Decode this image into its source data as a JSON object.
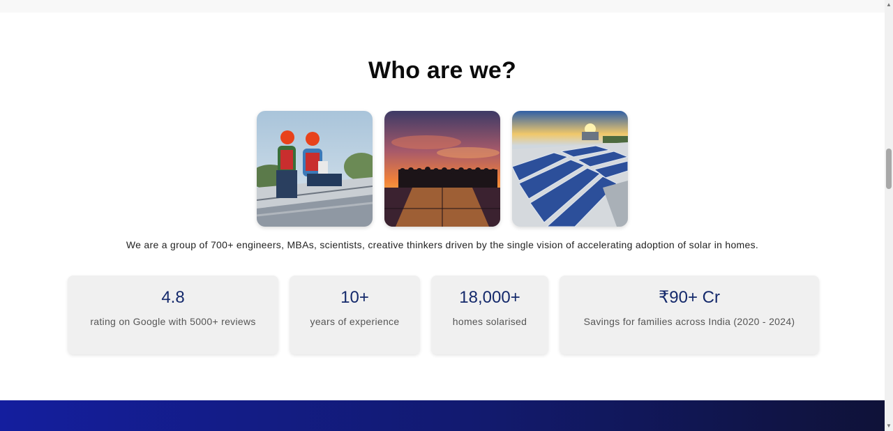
{
  "section": {
    "title": "Who are we?",
    "intro": "We are a group of 700+ engineers, MBAs, scientists, creative thinkers driven by the single vision of accelerating adoption of solar in homes."
  },
  "gallery": {
    "images": [
      {
        "name": "engineers-installing-panels"
      },
      {
        "name": "team-silhouette-sunset"
      },
      {
        "name": "rooftop-solar-array"
      }
    ]
  },
  "stats": [
    {
      "value": "4.8",
      "label": "rating on Google with 5000+ reviews"
    },
    {
      "value": "10+",
      "label": "years of experience"
    },
    {
      "value": "18,000+",
      "label": "homes solarised"
    },
    {
      "value": "₹90+ Cr",
      "label": "Savings for families across India (2020 - 2024)"
    }
  ],
  "colors": {
    "accent": "#14296b",
    "card_bg": "#f0f0f0",
    "footer_gradient_start": "#141e9e",
    "footer_gradient_end": "#0f1238"
  }
}
